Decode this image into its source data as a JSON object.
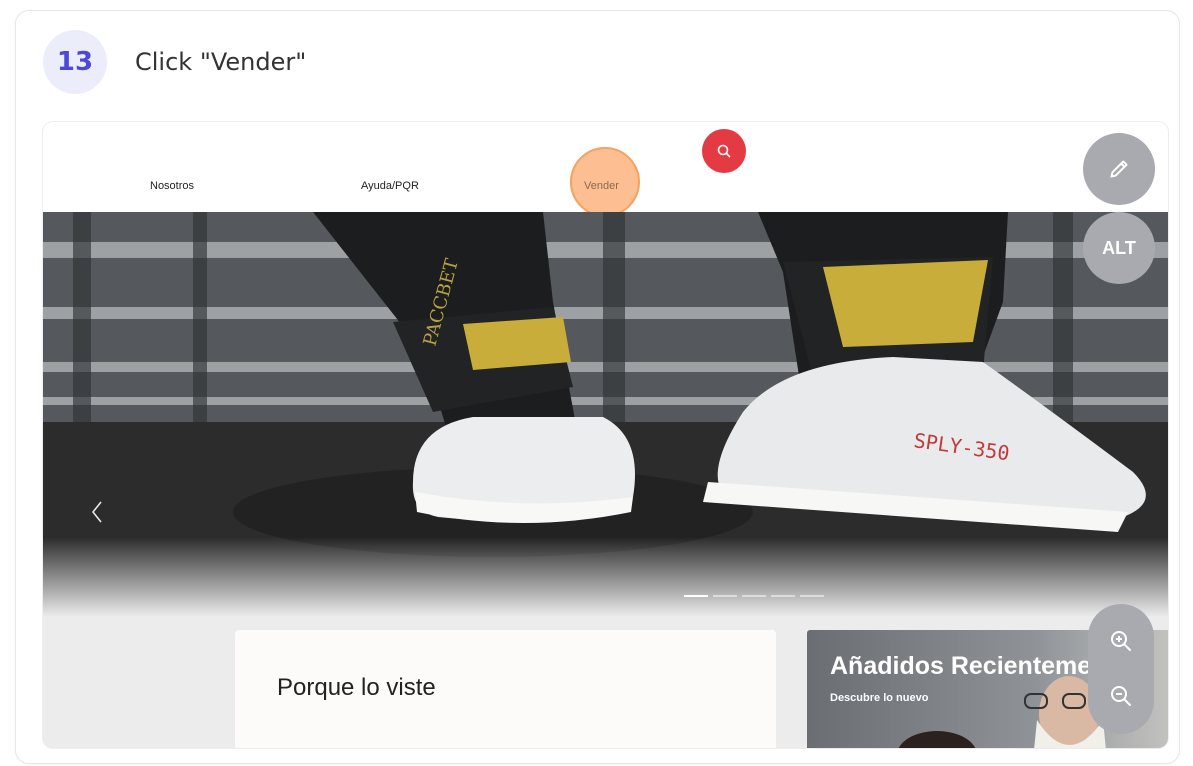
{
  "step": {
    "number": "13",
    "instruction": "Click \"Vender\""
  },
  "navbar": {
    "links": [
      "Nosotros",
      "Ayuda/PQR",
      "Vender"
    ]
  },
  "hero": {
    "sock_text_left": "PACCBET",
    "shoe_text_right": "SPLY-350"
  },
  "sections": {
    "left_title": "Porque lo viste",
    "right_title": "Añadidos Recientemente",
    "right_subtitle": "Descubre lo nuevo"
  },
  "controls": {
    "alt_label": "ALT"
  },
  "colors": {
    "accent_step": "#4b49d6",
    "search": "#e43a44",
    "highlight": "#fca86e",
    "control": "#a9aaaf"
  },
  "icons": [
    "search-icon",
    "pencil-icon",
    "chevron-left-icon",
    "zoom-in-icon",
    "zoom-out-icon"
  ]
}
